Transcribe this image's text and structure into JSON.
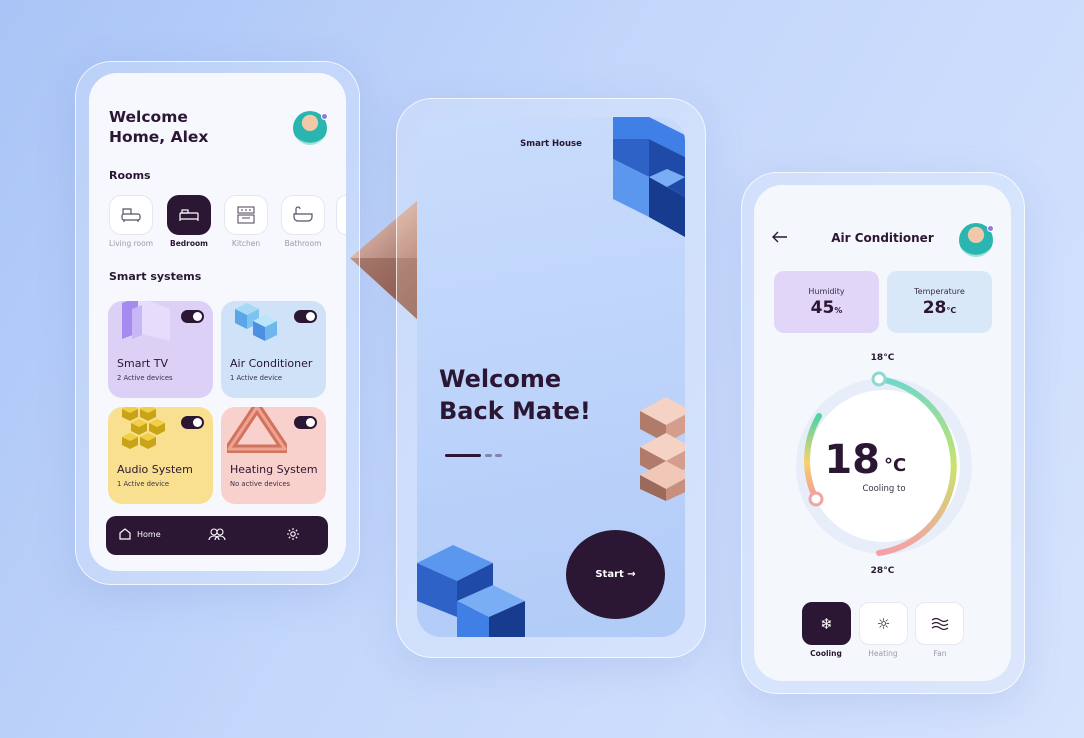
{
  "left_phone": {
    "welcome_line1": "Welcome",
    "welcome_line2": "Home, Alex",
    "rooms_heading": "Rooms",
    "rooms": [
      {
        "label": "Living room",
        "icon": "sofa-icon"
      },
      {
        "label": "Bedroom",
        "icon": "bed-icon",
        "active": true
      },
      {
        "label": "Kitchen",
        "icon": "kitchen-icon"
      },
      {
        "label": "Bathroom",
        "icon": "bathtub-icon"
      }
    ],
    "systems_heading": "Smart systems",
    "systems": [
      {
        "name": "Smart TV",
        "sub": "2 Active devices",
        "color": "#dcd0f7",
        "on": true
      },
      {
        "name": "Air Conditioner",
        "sub": "1 Active device",
        "color": "#cfe2f8",
        "on": true
      },
      {
        "name": "Audio System",
        "sub": "1 Active device",
        "color": "#f9e091",
        "on": true
      },
      {
        "name": "Heating System",
        "sub": "No active devices",
        "color": "#f8d1cc",
        "on": true
      }
    ],
    "nav": {
      "home_label": "Home",
      "items": [
        "home-icon",
        "users-icon",
        "settings-icon"
      ]
    }
  },
  "middle_phone": {
    "brand": "Smart House",
    "title_line1": "Welcome",
    "title_line2": "Back Mate!",
    "start_label": "Start →"
  },
  "right_phone": {
    "title": "Air Conditioner",
    "humidity": {
      "label": "Humidity",
      "value": "45",
      "unit": "%"
    },
    "temperature": {
      "label": "Temperature",
      "value": "28",
      "unit": "°C"
    },
    "scale_top": "18°C",
    "scale_bottom": "28°C",
    "dial": {
      "value": "18",
      "unit": "°C",
      "caption": "Cooling to"
    },
    "modes": [
      {
        "label": "Cooling",
        "icon": "snowflake-icon",
        "active": true
      },
      {
        "label": "Heating",
        "icon": "sun-icon"
      },
      {
        "label": "Fan",
        "icon": "wind-icon"
      }
    ]
  },
  "colors": {
    "accent_dark": "#2b1733",
    "background": "#b5cdf8"
  }
}
